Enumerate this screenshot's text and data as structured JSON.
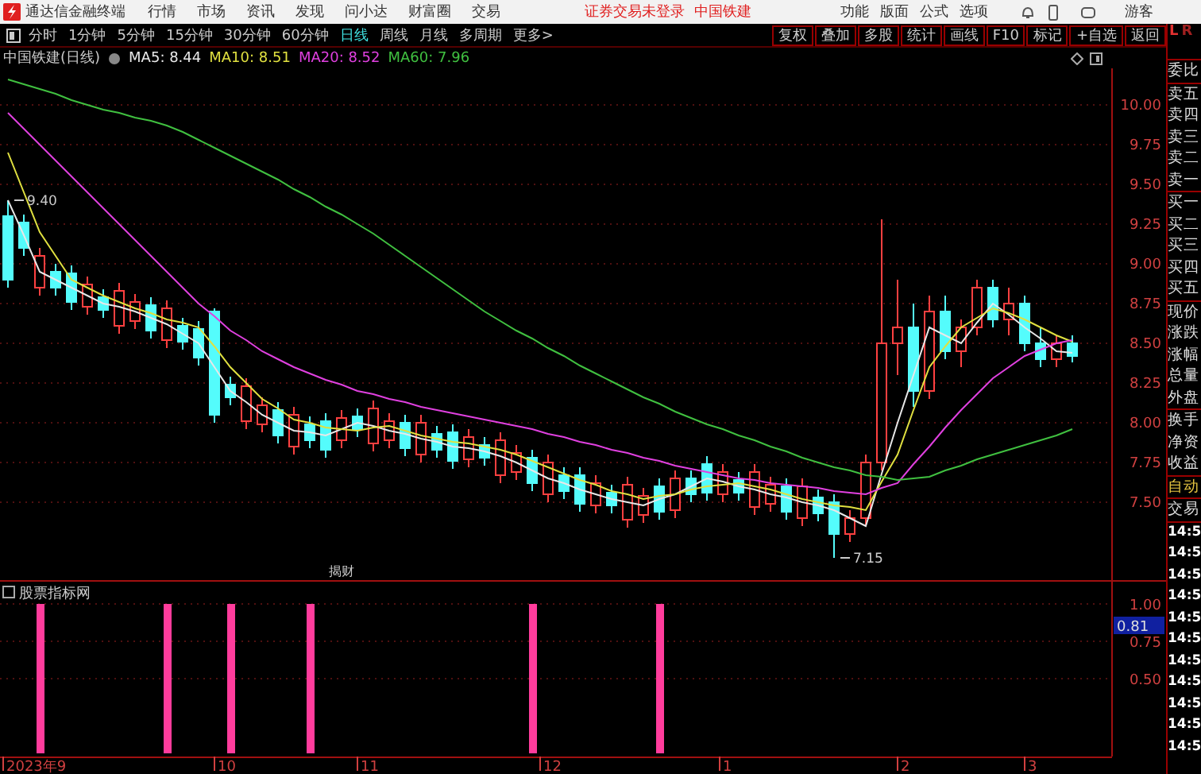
{
  "app_bar": {
    "title": "通达信金融终端",
    "menus": [
      "行情",
      "市场",
      "资讯",
      "发现",
      "问小达",
      "财富圈",
      "交易"
    ],
    "status": [
      "证券交易未登录",
      "中国铁建"
    ],
    "right_menus": [
      "功能",
      "版面",
      "公式",
      "选项"
    ],
    "user": "游客"
  },
  "toolbar": {
    "periods": [
      {
        "label": "分时",
        "selected": false
      },
      {
        "label": "1分钟",
        "selected": false
      },
      {
        "label": "5分钟",
        "selected": false
      },
      {
        "label": "15分钟",
        "selected": false
      },
      {
        "label": "30分钟",
        "selected": false
      },
      {
        "label": "60分钟",
        "selected": false
      },
      {
        "label": "日线",
        "selected": true
      },
      {
        "label": "周线",
        "selected": false
      },
      {
        "label": "月线",
        "selected": false
      },
      {
        "label": "多周期",
        "selected": false
      },
      {
        "label": "更多>",
        "selected": false
      }
    ],
    "buttons": [
      "复权",
      "叠加",
      "多股",
      "统计",
      "画线",
      "F10",
      "标记",
      "+自选",
      "返回"
    ]
  },
  "info_line": {
    "title": "中国铁建(日线)",
    "legend": [
      ": 8.44",
      ": 8.51",
      ": 8.52",
      ": 7.96"
    ]
  },
  "price_chart": {
    "event_marker": "揭财",
    "chart_data": {
      "type": "candlestick",
      "ylim": [
        7.0,
        10.23
      ],
      "grid": true,
      "yticks": [
        {
          "value": 10,
          "label": "10.00"
        },
        {
          "value": 9.75,
          "label": "9.75"
        },
        {
          "value": 9.5,
          "label": "9.50"
        },
        {
          "value": 9.25,
          "label": "9.25"
        },
        {
          "value": 9,
          "label": "9.00"
        },
        {
          "value": 8.75,
          "label": "8.75"
        },
        {
          "value": 8.5,
          "label": "8.50"
        },
        {
          "value": 8.25,
          "label": "8.25"
        },
        {
          "value": 8,
          "label": "8.00"
        },
        {
          "value": 7.75,
          "label": "7.75"
        },
        {
          "value": 7.5,
          "label": "7.50"
        }
      ],
      "ohlc": [
        [
          9.3,
          9.4,
          8.85,
          8.9
        ],
        [
          9.26,
          9.31,
          9.05,
          9.1
        ],
        [
          8.85,
          9.1,
          8.8,
          9.05
        ],
        [
          8.95,
          9.0,
          8.8,
          8.85
        ],
        [
          8.94,
          8.99,
          8.71,
          8.76
        ],
        [
          8.73,
          8.92,
          8.68,
          8.87
        ],
        [
          8.79,
          8.84,
          8.66,
          8.71
        ],
        [
          8.61,
          8.88,
          8.56,
          8.83
        ],
        [
          8.64,
          8.81,
          8.59,
          8.76
        ],
        [
          8.74,
          8.79,
          8.53,
          8.58
        ],
        [
          8.52,
          8.77,
          8.47,
          8.72
        ],
        [
          8.61,
          8.66,
          8.46,
          8.51
        ],
        [
          8.59,
          8.64,
          8.36,
          8.41
        ],
        [
          8.7,
          8.72,
          8.0,
          8.05
        ],
        [
          8.24,
          8.29,
          8.11,
          8.16
        ],
        [
          8.01,
          8.28,
          7.96,
          8.23
        ],
        [
          7.99,
          8.16,
          7.94,
          8.11
        ],
        [
          8.08,
          8.13,
          7.87,
          7.92
        ],
        [
          7.85,
          8.1,
          7.8,
          8.05
        ],
        [
          7.99,
          8.04,
          7.84,
          7.89
        ],
        [
          8.01,
          8.06,
          7.78,
          7.83
        ],
        [
          7.89,
          8.08,
          7.84,
          8.03
        ],
        [
          8.04,
          8.09,
          7.91,
          7.96
        ],
        [
          7.87,
          8.14,
          7.82,
          8.09
        ],
        [
          7.89,
          8.06,
          7.84,
          8.01
        ],
        [
          8.0,
          8.05,
          7.79,
          7.84
        ],
        [
          7.8,
          8.05,
          7.75,
          8.0
        ],
        [
          7.93,
          7.98,
          7.78,
          7.83
        ],
        [
          7.94,
          7.99,
          7.71,
          7.76
        ],
        [
          7.77,
          7.96,
          7.72,
          7.91
        ],
        [
          7.86,
          7.91,
          7.73,
          7.78
        ],
        [
          7.67,
          7.94,
          7.62,
          7.89
        ],
        [
          7.69,
          7.86,
          7.64,
          7.81
        ],
        [
          7.78,
          7.83,
          7.57,
          7.62
        ],
        [
          7.55,
          7.8,
          7.5,
          7.75
        ],
        [
          7.67,
          7.72,
          7.52,
          7.57
        ],
        [
          7.67,
          7.72,
          7.44,
          7.49
        ],
        [
          7.48,
          7.67,
          7.43,
          7.62
        ],
        [
          7.56,
          7.61,
          7.43,
          7.48
        ],
        [
          7.39,
          7.66,
          7.34,
          7.61
        ],
        [
          7.42,
          7.59,
          7.37,
          7.54
        ],
        [
          7.6,
          7.65,
          7.39,
          7.44
        ],
        [
          7.45,
          7.7,
          7.4,
          7.65
        ],
        [
          7.65,
          7.7,
          7.5,
          7.55
        ],
        [
          7.74,
          7.79,
          7.51,
          7.56
        ],
        [
          7.55,
          7.74,
          7.5,
          7.69
        ],
        [
          7.64,
          7.69,
          7.51,
          7.56
        ],
        [
          7.47,
          7.74,
          7.42,
          7.69
        ],
        [
          7.49,
          7.66,
          7.44,
          7.61
        ],
        [
          7.6,
          7.65,
          7.39,
          7.44
        ],
        [
          7.4,
          7.65,
          7.35,
          7.6
        ],
        [
          7.53,
          7.58,
          7.38,
          7.43
        ],
        [
          7.5,
          7.55,
          7.15,
          7.3
        ],
        [
          7.3,
          7.45,
          7.25,
          7.4
        ],
        [
          7.4,
          7.8,
          7.35,
          7.75
        ],
        [
          7.75,
          9.28,
          7.7,
          8.5
        ],
        [
          8.5,
          8.9,
          8.3,
          8.6
        ],
        [
          8.6,
          8.75,
          8.1,
          8.2
        ],
        [
          8.2,
          8.8,
          8.15,
          8.7
        ],
        [
          8.7,
          8.8,
          8.4,
          8.45
        ],
        [
          8.45,
          8.65,
          8.35,
          8.6
        ],
        [
          8.6,
          8.9,
          8.55,
          8.85
        ],
        [
          8.85,
          8.9,
          8.6,
          8.65
        ],
        [
          8.65,
          8.85,
          8.55,
          8.75
        ],
        [
          8.75,
          8.8,
          8.45,
          8.5
        ],
        [
          8.5,
          8.6,
          8.35,
          8.4
        ],
        [
          8.4,
          8.55,
          8.35,
          8.5
        ],
        [
          8.5,
          8.55,
          8.38,
          8.42
        ]
      ],
      "series": [
        {
          "name": "MA5",
          "type": "line",
          "color": "#e8e8e8",
          "values": [
            9.4,
            9.18,
            8.95,
            8.9,
            8.85,
            8.8,
            8.75,
            8.73,
            8.7,
            8.66,
            8.62,
            8.56,
            8.5,
            8.35,
            8.2,
            8.13,
            8.05,
            8.0,
            7.95,
            7.94,
            7.92,
            7.96,
            8.0,
            7.98,
            7.95,
            7.93,
            7.9,
            7.88,
            7.85,
            7.84,
            7.82,
            7.79,
            7.75,
            7.7,
            7.65,
            7.62,
            7.58,
            7.55,
            7.52,
            7.5,
            7.48,
            7.52,
            7.55,
            7.6,
            7.65,
            7.63,
            7.6,
            7.58,
            7.55,
            7.53,
            7.5,
            7.48,
            7.45,
            7.4,
            7.35,
            7.68,
            8.0,
            8.3,
            8.6,
            8.55,
            8.5,
            8.63,
            8.75,
            8.68,
            8.6,
            8.53,
            8.45,
            8.44
          ]
        },
        {
          "name": "MA10",
          "type": "line",
          "color": "#e0e040",
          "values": [
            9.7,
            9.45,
            9.2,
            9.05,
            8.9,
            8.85,
            8.8,
            8.76,
            8.72,
            8.69,
            8.65,
            8.63,
            8.6,
            8.48,
            8.35,
            8.25,
            8.15,
            8.09,
            8.02,
            8.0,
            7.97,
            7.96,
            7.95,
            7.97,
            7.98,
            7.95,
            7.92,
            7.9,
            7.88,
            7.87,
            7.85,
            7.83,
            7.8,
            7.76,
            7.72,
            7.68,
            7.64,
            7.61,
            7.57,
            7.55,
            7.52,
            7.54,
            7.55,
            7.58,
            7.6,
            7.61,
            7.62,
            7.6,
            7.58,
            7.55,
            7.52,
            7.5,
            7.48,
            7.47,
            7.45,
            7.63,
            7.8,
            8.08,
            8.35,
            8.48,
            8.6,
            8.66,
            8.72,
            8.69,
            8.65,
            8.6,
            8.55,
            8.51
          ]
        },
        {
          "name": "MA20",
          "type": "line",
          "color": "#e040e0",
          "values": [
            9.95,
            9.85,
            9.75,
            9.65,
            9.55,
            9.45,
            9.35,
            9.25,
            9.15,
            9.05,
            8.95,
            8.85,
            8.75,
            8.67,
            8.58,
            8.52,
            8.45,
            8.4,
            8.35,
            8.31,
            8.27,
            8.24,
            8.2,
            8.18,
            8.15,
            8.13,
            8.1,
            8.08,
            8.06,
            8.04,
            8.02,
            8.0,
            7.98,
            7.96,
            7.93,
            7.91,
            7.88,
            7.86,
            7.83,
            7.81,
            7.78,
            7.76,
            7.73,
            7.71,
            7.69,
            7.67,
            7.65,
            7.64,
            7.62,
            7.61,
            7.6,
            7.59,
            7.57,
            7.56,
            7.55,
            7.59,
            7.62,
            7.74,
            7.85,
            7.97,
            8.08,
            8.18,
            8.28,
            8.35,
            8.42,
            8.46,
            8.5,
            8.52
          ]
        },
        {
          "name": "MA60",
          "type": "line",
          "color": "#40c040",
          "values": [
            10.16,
            10.13,
            10.1,
            10.07,
            10.03,
            10.0,
            9.97,
            9.95,
            9.92,
            9.9,
            9.87,
            9.83,
            9.78,
            9.73,
            9.68,
            9.63,
            9.58,
            9.53,
            9.47,
            9.42,
            9.36,
            9.31,
            9.25,
            9.19,
            9.12,
            9.05,
            8.98,
            8.91,
            8.84,
            8.77,
            8.7,
            8.64,
            8.58,
            8.53,
            8.47,
            8.42,
            8.36,
            8.31,
            8.26,
            8.21,
            8.16,
            8.12,
            8.07,
            8.03,
            7.99,
            7.96,
            7.92,
            7.89,
            7.85,
            7.82,
            7.78,
            7.75,
            7.72,
            7.7,
            7.67,
            7.66,
            7.64,
            7.65,
            7.66,
            7.7,
            7.73,
            7.77,
            7.8,
            7.83,
            7.86,
            7.89,
            7.92,
            7.96
          ]
        }
      ],
      "annotations": [
        "9.40",
        "7.15"
      ]
    }
  },
  "indicator_chart": {
    "month_labels": [
      "2023年9",
      "10",
      "11",
      "12",
      "1",
      "2",
      "3"
    ],
    "cursor_value": "0.81",
    "chart_data": {
      "type": "bar",
      "title": "股票指标网",
      "ylim": [
        0,
        1
      ],
      "grid": true,
      "yticks": [
        {
          "value": 1,
          "label": "1.00"
        },
        {
          "value": 0.75,
          "label": "0.75"
        },
        {
          "value": 0.5,
          "label": "0.50"
        }
      ],
      "values": [
        0,
        0,
        1,
        0,
        0,
        0,
        0,
        0,
        0,
        0,
        1,
        0,
        0,
        0,
        1,
        0,
        0,
        0,
        0,
        1,
        0,
        0,
        0,
        0,
        0,
        0,
        0,
        0,
        0,
        0,
        0,
        0,
        0,
        1,
        0,
        0,
        0,
        0,
        0,
        0,
        0,
        1,
        0,
        0,
        0,
        0,
        0,
        0,
        0,
        0,
        0,
        0,
        0,
        0,
        0,
        0,
        0,
        0,
        0,
        0,
        0,
        0,
        0,
        0,
        0,
        0,
        0,
        0,
        0,
        0
      ]
    }
  },
  "right_panel": {
    "header": [
      "L",
      "R"
    ],
    "groups": [
      [
        {
          "label": "委比",
          "kind": "field"
        }
      ],
      [
        {
          "label": "卖五",
          "kind": "field"
        },
        {
          "label": "卖四",
          "kind": "field"
        },
        {
          "label": "卖三",
          "kind": "field"
        },
        {
          "label": "卖二",
          "kind": "field"
        },
        {
          "label": "卖一",
          "kind": "field"
        }
      ],
      [
        {
          "label": "买一",
          "kind": "field"
        },
        {
          "label": "买二",
          "kind": "field"
        },
        {
          "label": "买三",
          "kind": "field"
        },
        {
          "label": "买四",
          "kind": "field"
        },
        {
          "label": "买五",
          "kind": "field"
        }
      ],
      [
        {
          "label": "现价",
          "kind": "field"
        },
        {
          "label": "涨跌",
          "kind": "field"
        },
        {
          "label": "涨幅",
          "kind": "field"
        },
        {
          "label": "总量",
          "kind": "field"
        },
        {
          "label": "外盘",
          "kind": "field"
        }
      ],
      [
        {
          "label": "换手",
          "kind": "field"
        },
        {
          "label": "净资",
          "kind": "field"
        },
        {
          "label": "收益",
          "kind": "field"
        }
      ],
      [
        {
          "label": "自动",
          "kind": "highlight"
        }
      ],
      [
        {
          "label": "交易",
          "kind": "field"
        }
      ],
      [
        {
          "label": "14:5",
          "kind": "time"
        },
        {
          "label": "14:5",
          "kind": "time"
        },
        {
          "label": "14:5",
          "kind": "time"
        },
        {
          "label": "14:5",
          "kind": "time"
        },
        {
          "label": "14:5",
          "kind": "time"
        },
        {
          "label": "14:5",
          "kind": "time"
        },
        {
          "label": "14:5",
          "kind": "time"
        },
        {
          "label": "14:5",
          "kind": "time"
        },
        {
          "label": "14:5",
          "kind": "time"
        },
        {
          "label": "14:5",
          "kind": "time"
        },
        {
          "label": "14:5",
          "kind": "time"
        }
      ]
    ]
  }
}
